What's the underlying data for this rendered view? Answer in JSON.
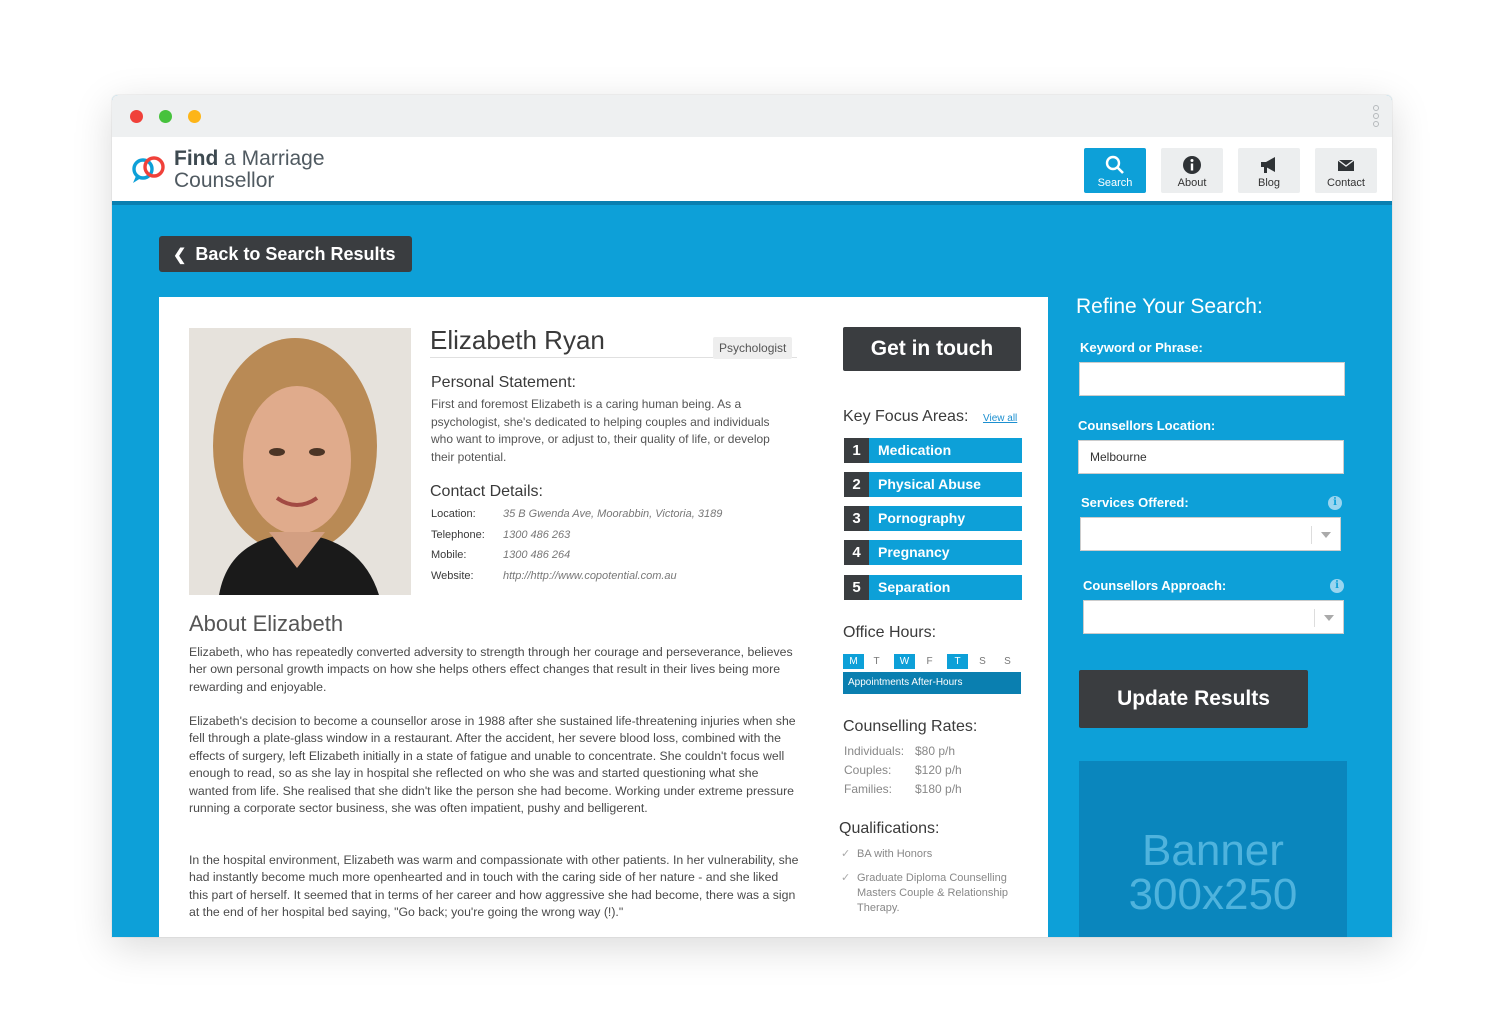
{
  "header": {
    "logo_line1_bold": "Find",
    "logo_line1_rest": " a Marriage",
    "logo_line2": "Counsellor",
    "nav": [
      {
        "label": "Search",
        "icon": "search-icon",
        "active": true
      },
      {
        "label": "About",
        "icon": "info-icon",
        "active": false
      },
      {
        "label": "Blog",
        "icon": "megaphone-icon",
        "active": false
      },
      {
        "label": "Contact",
        "icon": "envelope-icon",
        "active": false
      }
    ]
  },
  "back_button": "Back to Search Results",
  "profile": {
    "name": "Elizabeth Ryan",
    "badge": "Psychologist",
    "personal_statement_title": "Personal Statement:",
    "personal_statement": "First and foremost Elizabeth is a caring human being. As a psychologist, she's dedicated to helping couples and individuals who want to improve, or adjust to, their quality of life, or develop their potential.",
    "contact_title": "Contact Details:",
    "contact": [
      {
        "label": "Location:",
        "value": "35 B Gwenda Ave, Moorabbin, Victoria, 3189"
      },
      {
        "label": "Telephone:",
        "value": "1300 486 263"
      },
      {
        "label": "Mobile:",
        "value": "1300 486 264"
      },
      {
        "label": "Website:",
        "value": "http://http://www.copotential.com.au"
      }
    ],
    "about_title": "About Elizabeth",
    "about": [
      "Elizabeth, who has repeatedly converted adversity to strength through her courage and perseverance, believes her own personal growth impacts on how she helps others effect changes that result in their lives being more rewarding and enjoyable.",
      "Elizabeth's decision to become a counsellor arose in 1988 after she sustained life-threatening injuries when she fell through a plate-glass window in a restaurant. After the accident, her severe blood loss, combined with the effects of surgery, left Elizabeth initially in a state of fatigue and unable to concentrate. She couldn't focus well enough to read, so as she lay in hospital she reflected on who she was and started questioning what she wanted from life. She realised that she didn't like the person she had become. Working under extreme pressure running a corporate sector business, she was often impatient, pushy and belligerent.",
      "In the hospital environment, Elizabeth was warm and compassionate with other patients. In her vulnerability, she had instantly become much more openhearted and in touch with the caring side of her nature - and she liked this part of herself. It seemed that in terms of her career and how aggressive she had become, there was a sign at the end of her hospital bed saying, \"Go back; you're going the wrong way (!).\""
    ]
  },
  "sidebar": {
    "get_in_touch": "Get in touch",
    "key_focus_title": "Key Focus Areas:",
    "view_all": "View all",
    "focus_areas": [
      {
        "num": "1",
        "label": "Medication"
      },
      {
        "num": "2",
        "label": "Physical Abuse"
      },
      {
        "num": "3",
        "label": "Pornography"
      },
      {
        "num": "4",
        "label": "Pregnancy"
      },
      {
        "num": "5",
        "label": "Separation"
      }
    ],
    "office_hours_title": "Office Hours:",
    "days": [
      {
        "d": "M",
        "on": true
      },
      {
        "d": "T",
        "on": false
      },
      {
        "d": "W",
        "on": true
      },
      {
        "d": "F",
        "on": false
      },
      {
        "d": "T",
        "on": true
      },
      {
        "d": "S",
        "on": false
      },
      {
        "d": "S",
        "on": false
      }
    ],
    "appointments": "Appointments After-Hours",
    "rates_title": "Counselling Rates:",
    "rates": [
      {
        "label": "Individuals:",
        "value": "$80 p/h"
      },
      {
        "label": "Couples:",
        "value": "$120 p/h"
      },
      {
        "label": "Families:",
        "value": "$180 p/h"
      }
    ],
    "qualifications_title": "Qualifications:",
    "qualifications": [
      "BA with Honors",
      "Graduate Diploma Counselling Masters Couple & Relationship Therapy."
    ]
  },
  "refine": {
    "title": "Refine Your Search:",
    "keyword_label": "Keyword or Phrase:",
    "keyword_value": "",
    "location_label": "Counsellors Location:",
    "location_value": "Melbourne",
    "services_label": "Services Offered:",
    "approach_label": "Counsellors Approach:",
    "update_button": "Update Results",
    "banner_line1": "Banner",
    "banner_line2": "300x250"
  },
  "colors": {
    "brand_blue": "#0da0d8",
    "dark": "#3a3d40"
  }
}
